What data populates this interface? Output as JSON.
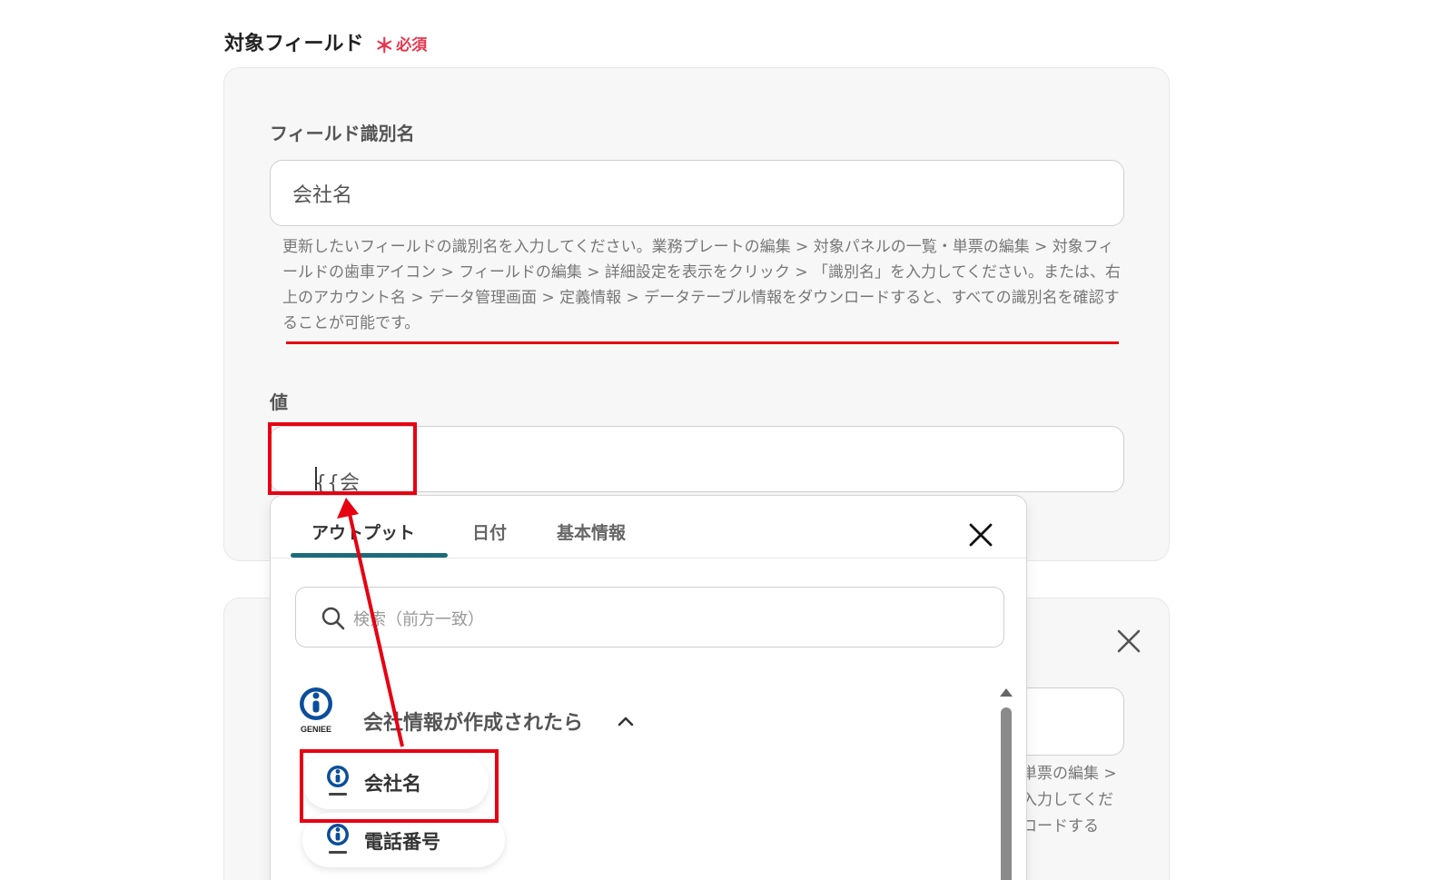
{
  "section": {
    "title": "対象フィールド",
    "required_mark": "＊",
    "required_label": "必須"
  },
  "field_id": {
    "label": "フィールド識別名",
    "value": "会社名",
    "help": "更新したいフィールドの識別名を入力してください。業務プレートの編集 > 対象パネルの一覧・単票の編集 > 対象フィールドの歯車アイコン > フィールドの編集 > 詳細設定を表示をクリック > 「識別名」を入力してください。または、右上のアカウント名 > データ管理画面 > 定義情報 > データテーブル情報をダウンロードすると、すべての識別名を確認することが可能です。"
  },
  "value_field": {
    "label": "値",
    "value": "{{会社名}}"
  },
  "panel2": {
    "help_fragments": [
      "単票の編集 >",
      "入力してくだ",
      "ロードする"
    ]
  },
  "dropdown": {
    "tabs": [
      {
        "label": "アウトプット",
        "active": true
      },
      {
        "label": "日付",
        "active": false
      },
      {
        "label": "基本情報",
        "active": false
      }
    ],
    "search_placeholder": "検索（前方一致）",
    "group": {
      "title": "会社情報が作成されたら",
      "logo_text": "GENIEE",
      "expanded": true
    },
    "items": [
      {
        "label": "会社名",
        "icon": "geniee-icon"
      },
      {
        "label": "電話番号",
        "icon": "geniee-icon"
      }
    ]
  },
  "colors": {
    "accent_red": "#e60012",
    "required_red": "#e8354b",
    "tab_underline": "#1b6b7a",
    "geniee_blue": "#0a4e9b"
  }
}
